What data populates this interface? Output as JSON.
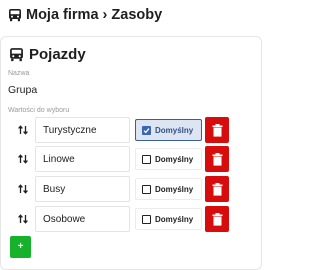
{
  "breadcrumb": {
    "text": "Moja firma › Zasoby",
    "icon": "bus-icon"
  },
  "card": {
    "title": "Pojazdy",
    "title_icon": "bus-icon",
    "name_label": "Nazwa",
    "name_value": "Grupa",
    "options_label": "Wartości do wyboru",
    "default_label": "Domyślny",
    "items": [
      {
        "name": "Turystyczne",
        "is_default": true
      },
      {
        "name": "Linowe",
        "is_default": false
      },
      {
        "name": "Busy",
        "is_default": false
      },
      {
        "name": "Osobowe",
        "is_default": false
      }
    ],
    "add_label": "+"
  },
  "colors": {
    "delete": "#d70c0c",
    "add": "#17b22c",
    "accent": "#3b66b4",
    "active_bg": "#dde5f2"
  }
}
